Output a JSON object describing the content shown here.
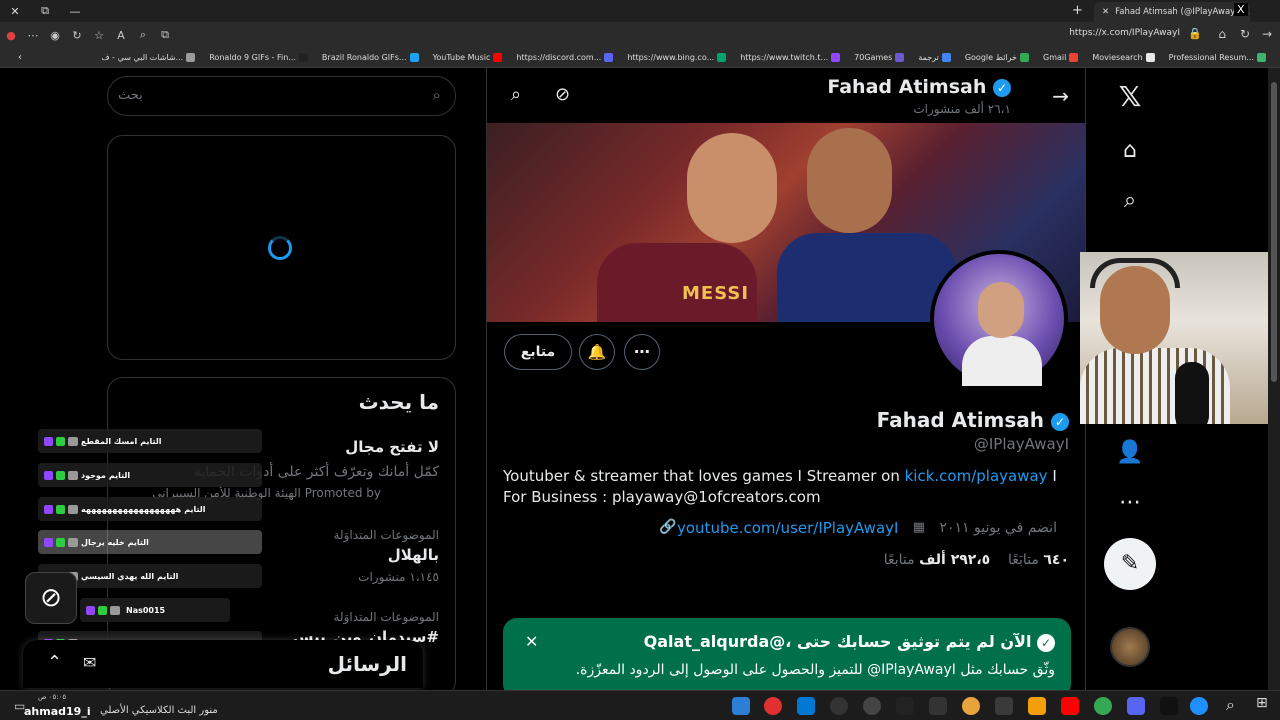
{
  "browser": {
    "tab_title": "Fahad Atimsah (@IPlayAwayI) / X",
    "url": "https://x.com/IPlayAwayI",
    "bookmarks": [
      {
        "label": "Professional Resum...",
        "color": "#3cb371"
      },
      {
        "label": "Moviesearch",
        "color": "#e8e8e8"
      },
      {
        "label": "Gmail",
        "color": "#ea4335"
      },
      {
        "label": "Google خرائط",
        "color": "#34a853"
      },
      {
        "label": "ترجمة",
        "color": "#4285f4"
      },
      {
        "label": "70Games",
        "color": "#6a5acd"
      },
      {
        "label": "https://www.twitch.t...",
        "color": "#9146ff"
      },
      {
        "label": "https://www.bing.co...",
        "color": "#00a36c"
      },
      {
        "label": "https://discord.com...",
        "color": "#5865f2"
      },
      {
        "label": "YouTube Music",
        "color": "#ff0000"
      },
      {
        "label": "Brazil Ronaldo GIFs...",
        "color": "#1da1f2"
      },
      {
        "label": "Ronaldo 9 GIFs - Fin...",
        "color": "#222"
      },
      {
        "label": "شاشات البي سي - ف...",
        "color": "#999"
      }
    ]
  },
  "left": {
    "search_placeholder": "بحث",
    "whats_happening_title": "ما يحدث",
    "promo": {
      "headline": "لا تفتح مجال",
      "description": "كمّل أمانك وتعرّف أكثر على أدوات الحماية",
      "promoted_by": "Promoted by الهيئة الوطنية للأمن السيبراني"
    },
    "trends": [
      {
        "category": "الموضوعات المتداوَلة",
        "name": "بالهلال",
        "count": "١،١٤٥ منشورات"
      },
      {
        "category": "الموضوعات المتداوَلة",
        "name": "#سيدمان_وين_بيس",
        "count": ""
      }
    ]
  },
  "chat": [
    {
      "user": "التايم",
      "text": "امسك المقطع",
      "highlight": false
    },
    {
      "user": "التايم",
      "text": "موجود",
      "highlight": false
    },
    {
      "user": "التايم",
      "text": "ههههههههههههههههههه",
      "highlight": false
    },
    {
      "user": "التايم",
      "text": "خليه يرجال",
      "highlight": true
    },
    {
      "user": "التايم",
      "text": "الله يهدي السيسي",
      "highlight": false
    },
    {
      "user": "Nas0015",
      "text": "",
      "highlight": false
    },
    {
      "user": "التايم",
      "text": "ههههههههههههههههههههه",
      "highlight": false
    }
  ],
  "messages_title": "الرسائل",
  "profile": {
    "header_name": "Fahad Atimsah",
    "header_posts": "٢٦،١ ألف منشورات",
    "name": "Fahad Atimsah",
    "handle": "@IPlayAwayI",
    "bio_prefix": "Youtuber & streamer that loves games I Streamer on ",
    "bio_link": "kick.com/playaway",
    "bio_suffix": " I For Business : playaway@1ofcreators.com",
    "website": "youtube.com/user/IPlayAwayI",
    "joined": "انضم في يونيو ٢٠١١",
    "following_count": "٦٤٠",
    "following_label": "متابَعًا",
    "followers_count": "٢٩٢،٥ ألف",
    "followers_label": "متابعًا",
    "follow_button": "متابع",
    "banner_text": "MESSI"
  },
  "verification_banner": {
    "title": "الآن لم يتم توثيق حسابك حتى ،@Qalat_alqurda",
    "text": "وثّق حسابك مثل IPlayAwayI@ للتميز والحصول على الوصول إلى الردود المعزّزة."
  },
  "taskbar": {
    "user": "ahmad19_i",
    "time": "٠٥:٠٥ ص",
    "song": "منور البث الكلاسيكي الأصلي"
  },
  "icons": {
    "x_logo": "𝕏",
    "home": "⌂",
    "search": "⌕",
    "profile": "👤",
    "more": "⋯",
    "post": "✎"
  },
  "colors": {
    "accent": "#1d9bf0",
    "verify_banner": "#00704a",
    "background": "#000000"
  }
}
